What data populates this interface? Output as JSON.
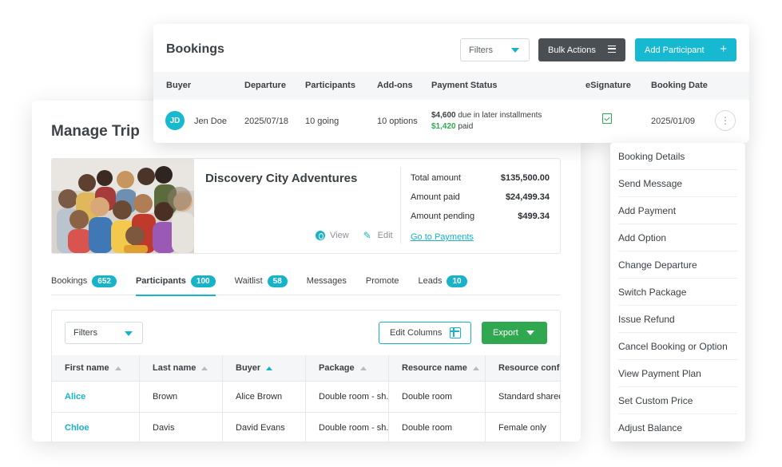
{
  "manage_trip": {
    "title": "Manage Trip",
    "trip": {
      "name": "Discovery City Adventures",
      "view_label": "View",
      "edit_label": "Edit",
      "amounts": [
        {
          "label": "Total amount",
          "value": "$135,500.00"
        },
        {
          "label": "Amount paid",
          "value": "$24,499.34"
        },
        {
          "label": "Amount pending",
          "value": "$499.34"
        }
      ],
      "payments_link": "Go to Payments"
    },
    "tabs": [
      {
        "label": "Bookings",
        "count": "652"
      },
      {
        "label": "Participants",
        "count": "100",
        "active": true
      },
      {
        "label": "Waitlist",
        "count": "58"
      },
      {
        "label": "Messages",
        "count": ""
      },
      {
        "label": "Promote",
        "count": ""
      },
      {
        "label": "Leads",
        "count": "10"
      }
    ],
    "table": {
      "filters_label": "Filters",
      "edit_columns_label": "Edit Columns",
      "export_label": "Export",
      "columns": [
        "First name",
        "Last name",
        "Buyer",
        "Package",
        "Resource name",
        "Resource config"
      ],
      "rows": [
        [
          "Alice",
          "Brown",
          "Alice Brown",
          "Double room - sh...",
          "Double room",
          "Standard shared"
        ],
        [
          "Chloe",
          "Davis",
          "David Evans",
          "Double room - sh...",
          "Double room",
          "Female only"
        ]
      ]
    }
  },
  "bookings": {
    "title": "Bookings",
    "filters_label": "Filters",
    "bulk_actions_label": "Bulk Actions",
    "add_participant_label": "Add Participant",
    "columns": [
      "Buyer",
      "Departure",
      "Participants",
      "Add-ons",
      "Payment Status",
      "eSignature",
      "Booking Date"
    ],
    "row": {
      "initials": "JD",
      "buyer": "Jen Doe",
      "departure": "2025/07/18",
      "participants": "10 going",
      "addons": "10 options",
      "due_amount": "$4,600",
      "due_text": "due in later installments",
      "paid_amount": "$1,420",
      "paid_text": "paid",
      "booking_date": "2025/01/09"
    },
    "colors": {
      "accent": "#16b9cf",
      "success": "#2fa84f",
      "dark": "#4a4f54"
    }
  },
  "dropdown": {
    "items": [
      "Booking Details",
      "Send Message",
      "Add Payment",
      "Add Option",
      "Change Departure",
      "Switch Package",
      "Issue Refund",
      "Cancel Booking or Option",
      "View Payment Plan",
      "Set Custom Price",
      "Adjust Balance"
    ]
  }
}
